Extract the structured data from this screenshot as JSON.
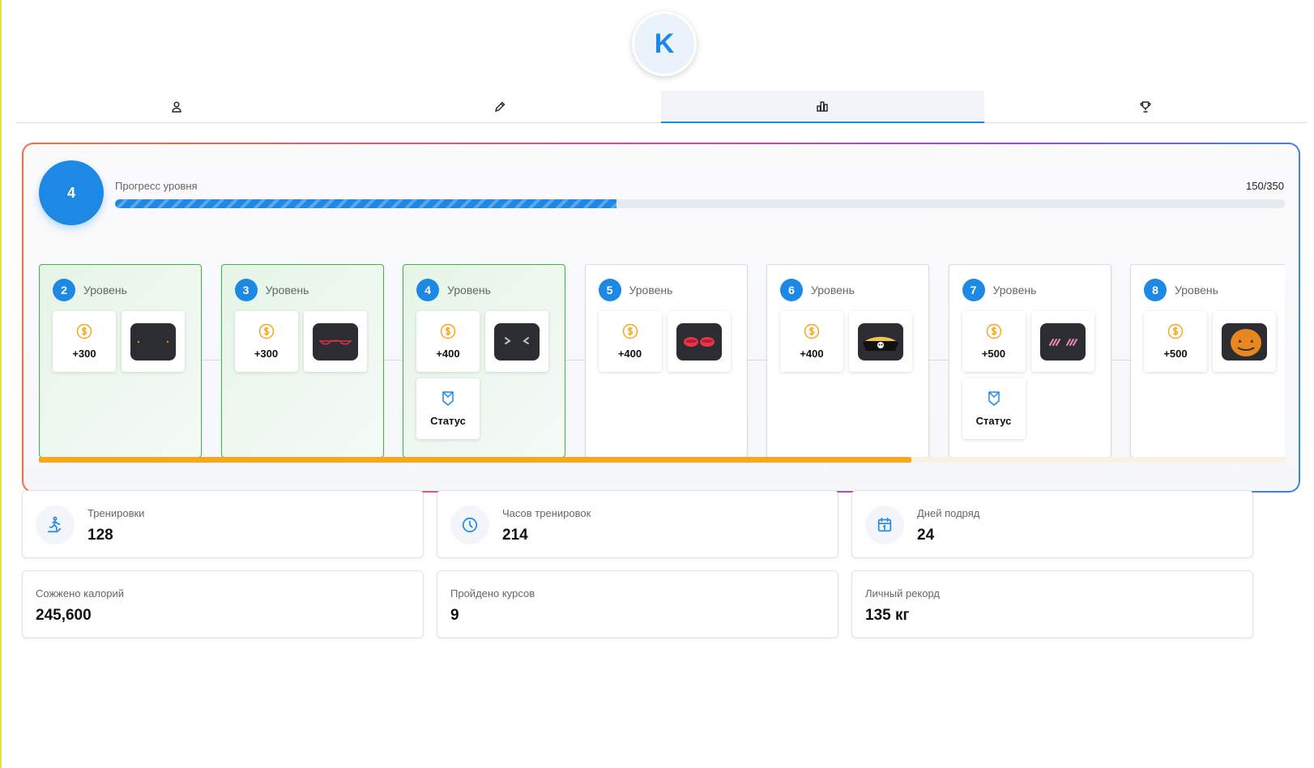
{
  "profile": {
    "avatar_letter": "K"
  },
  "tabs": [
    {
      "icon": "user-icon",
      "active": false
    },
    {
      "icon": "pencil-icon",
      "active": false
    },
    {
      "icon": "stats-icon",
      "active": true
    },
    {
      "icon": "trophy-icon",
      "active": false
    }
  ],
  "level_progress": {
    "current_level": "4",
    "label": "Прогресс уровня",
    "value_text": "150/350",
    "current": 150,
    "total": 350
  },
  "levels": [
    {
      "number": "2",
      "word": "Уровень",
      "completed": true,
      "coins": "+300",
      "item": "eyes-dots-item"
    },
    {
      "number": "3",
      "word": "Уровень",
      "completed": true,
      "coins": "+300",
      "item": "red-glasses-item"
    },
    {
      "number": "4",
      "word": "Уровень",
      "completed": true,
      "coins": "+400",
      "item": "angry-eyes-item",
      "status": "Статус"
    },
    {
      "number": "5",
      "word": "Уровень",
      "completed": false,
      "coins": "+400",
      "item": "red-lips-item"
    },
    {
      "number": "6",
      "word": "Уровень",
      "completed": false,
      "coins": "+400",
      "item": "pirate-hat-item"
    },
    {
      "number": "7",
      "word": "Уровень",
      "completed": false,
      "coins": "+500",
      "item": "pink-stripes-item",
      "status": "Статус"
    },
    {
      "number": "8",
      "word": "Уровень",
      "completed": false,
      "coins": "+500",
      "item": "pumpkin-item"
    }
  ],
  "levels_scroll_progress": 0.7,
  "colors": {
    "accent": "#1e88e5",
    "success": "#3bb54a",
    "coin": "#f6a81a"
  },
  "stats": [
    {
      "label": "Тренировки",
      "value": "128",
      "icon": "treadmill-icon"
    },
    {
      "label": "Часов тренировок",
      "value": "214",
      "icon": "clock-icon"
    },
    {
      "label": "Дней подряд",
      "value": "24",
      "icon": "calendar-icon"
    },
    {
      "label": "Сожжено калорий",
      "value": "245,600"
    },
    {
      "label": "Пройдено курсов",
      "value": "9"
    },
    {
      "label": "Личный рекорд",
      "value": "135 кг"
    }
  ]
}
